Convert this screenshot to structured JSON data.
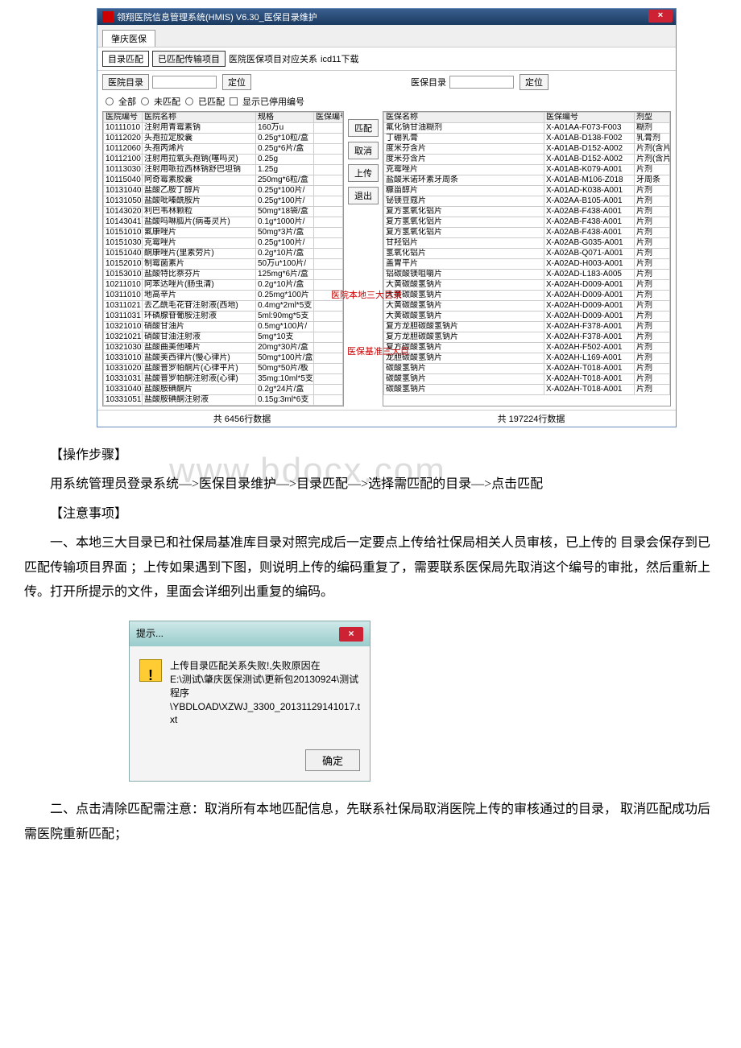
{
  "window": {
    "title": "领翔医院信息管理系统(HMIS) V6.30_医保目录维护",
    "close": "×"
  },
  "outerTab": "肇庆医保",
  "innerTabs": [
    "目录匹配",
    "已匹配传输项目",
    "医院医保项目对应关系",
    "icd11下载"
  ],
  "leftPanel": {
    "label": "医院目录",
    "locateBtn": "定位",
    "radios": [
      "全部",
      "未匹配",
      "已匹配"
    ],
    "checkLabel": "显示已停用编号",
    "cols": [
      "医院编号",
      "医院名称",
      "规格",
      "医保编号"
    ],
    "rows": [
      [
        "10111010",
        "注射用青霉素钠",
        "160万u",
        ""
      ],
      [
        "10112020",
        "头孢拉定胶囊",
        "0.25g*10粒/盒",
        ""
      ],
      [
        "10112060",
        "头孢丙烯片",
        "0.25g*6片/盒",
        ""
      ],
      [
        "10112100",
        "注射用拉氧头孢钠(噻吗灵)",
        "0.25g",
        ""
      ],
      [
        "10113030",
        "注射用哌拉西林钠舒巴坦钠",
        "1.25g",
        ""
      ],
      [
        "10115040",
        "阿奇霉素胶囊",
        "250mg*6粒/盒",
        ""
      ],
      [
        "10131040",
        "盐酸乙胺丁醇片",
        "0.25g*100片/",
        ""
      ],
      [
        "10131050",
        "盐酸吡嗪酰胺片",
        "0.25g*100片/",
        ""
      ],
      [
        "10143020",
        "利巴韦林颗粒",
        "50mg*18袋/盒",
        ""
      ],
      [
        "10143041",
        "盐酸吗啉胍片(病毒灵片)",
        "0.1g*1000片/",
        ""
      ],
      [
        "10151010",
        "氟康唑片",
        "50mg*3片/盒",
        ""
      ],
      [
        "10151030",
        "克霉唑片",
        "0.25g*100片/",
        ""
      ],
      [
        "10151040",
        "酮康唑片(里素劳片)",
        "0.2g*10片/盒",
        ""
      ],
      [
        "10152010",
        "制霉菌素片",
        "50万u*100片/",
        ""
      ],
      [
        "10153010",
        "盐酸特比萘芬片",
        "125mg*6片/盒",
        ""
      ],
      [
        "10211010",
        "阿苯达唑片(肠虫清)",
        "0.2g*10片/盒",
        ""
      ],
      [
        "10311010",
        "地高辛片",
        "0.25mg*100片",
        ""
      ],
      [
        "10311021",
        "去乙酰毛花苷注射液(西地)",
        "0.4mg*2ml*5支",
        ""
      ],
      [
        "10311031",
        "环磷腺苷葡胺注射液",
        "5ml:90mg*5支",
        ""
      ],
      [
        "10321010",
        "硝酸甘油片",
        "0.5mg*100片/",
        ""
      ],
      [
        "10321021",
        "硝酸甘油注射液",
        "5mg*10支",
        ""
      ],
      [
        "10321030",
        "盐酸曲美他嗪片",
        "20mg*30片/盒",
        ""
      ],
      [
        "10331010",
        "盐酸美西律片(慢心律片)",
        "50mg*100片/盒",
        ""
      ],
      [
        "10331020",
        "盐酸普罗帕酮片(心律平片)",
        "50mg*50片/板",
        ""
      ],
      [
        "10331031",
        "盐酸普罗帕酮注射液(心律)",
        "35mg:10ml*5支",
        ""
      ],
      [
        "10331040",
        "盐酸胺碘酮片",
        "0.2g*24片/盒",
        ""
      ],
      [
        "10331051",
        "盐酸胺碘酮注射液",
        "0.15g:3ml*6支",
        ""
      ]
    ],
    "footer": "共 6456行数据"
  },
  "midButtons": [
    "匹配",
    "取消",
    "上传",
    "退出"
  ],
  "redLabel1": "医院本地三大目录",
  "redLabel2": "医保基准三大目",
  "rightPanel": {
    "label": "医保目录",
    "locateBtn": "定位",
    "cols": [
      "医保名称",
      "医保编号",
      "剂型"
    ],
    "rows": [
      [
        "氟化钠甘油糊剂",
        "X-A01AA-F073-F003",
        "糊剂"
      ],
      [
        "丁硼乳膏",
        "X-A01AB-D138-F002",
        "乳膏剂"
      ],
      [
        "度米芬含片",
        "X-A01AB-D152-A002",
        "片剂(含片)"
      ],
      [
        "度米芬含片",
        "X-A01AB-D152-A002",
        "片剂(含片)"
      ],
      [
        "克霉唑片",
        "X-A01AB-K079-A001",
        "片剂"
      ],
      [
        "盐酸米诺环素牙周条",
        "X-A01AB-M106-Z018",
        "牙周条"
      ],
      [
        "糠甾醇片",
        "X-A01AD-K038-A001",
        "片剂"
      ],
      [
        "铋镁豆蔻片",
        "X-A02AA-B105-A001",
        "片剂"
      ],
      [
        "复方氢氧化铝片",
        "X-A02AB-F438-A001",
        "片剂"
      ],
      [
        "复方氢氧化铝片",
        "X-A02AB-F438-A001",
        "片剂"
      ],
      [
        "复方氢氧化铝片",
        "X-A02AB-F438-A001",
        "片剂"
      ],
      [
        "甘羟铝片",
        "X-A02AB-G035-A001",
        "片剂"
      ],
      [
        "氢氧化铝片",
        "X-A02AB-Q071-A001",
        "片剂"
      ],
      [
        "盖胃平片",
        "X-A02AD-H003-A001",
        "片剂"
      ],
      [
        "铝碳酸镁咀嚼片",
        "X-A02AD-L183-A005",
        "片剂"
      ],
      [
        "大黄碳酸氢钠片",
        "X-A02AH-D009-A001",
        "片剂"
      ],
      [
        "大黄碳酸氢钠片",
        "X-A02AH-D009-A001",
        "片剂"
      ],
      [
        "大黄碳酸氢钠片",
        "X-A02AH-D009-A001",
        "片剂"
      ],
      [
        "大黄碳酸氢钠片",
        "X-A02AH-D009-A001",
        "片剂"
      ],
      [
        "复方龙胆碳酸氢钠片",
        "X-A02AH-F378-A001",
        "片剂"
      ],
      [
        "复方龙胆碳酸氢钠片",
        "X-A02AH-F378-A001",
        "片剂"
      ],
      [
        "复方碳酸氢钠片",
        "X-A02AH-F502-A001",
        "片剂"
      ],
      [
        "龙胆碳酸氢钠片",
        "X-A02AH-L169-A001",
        "片剂"
      ],
      [
        "碳酸氢钠片",
        "X-A02AH-T018-A001",
        "片剂"
      ],
      [
        "碳酸氢钠片",
        "X-A02AH-T018-A001",
        "片剂"
      ],
      [
        "碳酸氢钠片",
        "X-A02AH-T018-A001",
        "片剂"
      ]
    ],
    "footer": "共 197224行数据"
  },
  "doc": {
    "h1": "【操作步骤】",
    "watermark": "www.bdocx.com",
    "p1": "用系统管理员登录系统—>医保目录维护—>目录匹配—>选择需匹配的目录—>点击匹配",
    "h2": "【注意事项】",
    "p2": "一、本地三大目录已和社保局基准库目录对照完成后一定要点上传给社保局相关人员审核，已上传的 目录会保存到已匹配传输项目界面 ；上传如果遇到下图，则说明上传的编码重复了，需要联系医保局先取消这个编号的审批，然后重新上传。打开所提示的文件，里面会详细列出重复的编码。",
    "p3": "二、点击清除匹配需注意：取消所有本地匹配信息，先联系社保局取消医院上传的审核通过的目录， 取消匹配成功后需医院重新匹配；"
  },
  "dialog": {
    "title": "提示...",
    "msg1": "上传目录匹配关系失败!,失败原因在",
    "msg2": "E:\\测试\\肇庆医保测试\\更新包20130924\\测试程序",
    "msg3": "\\YBDLOAD\\XZWJ_3300_20131129141017.txt",
    "ok": "确定",
    "x": "×"
  }
}
